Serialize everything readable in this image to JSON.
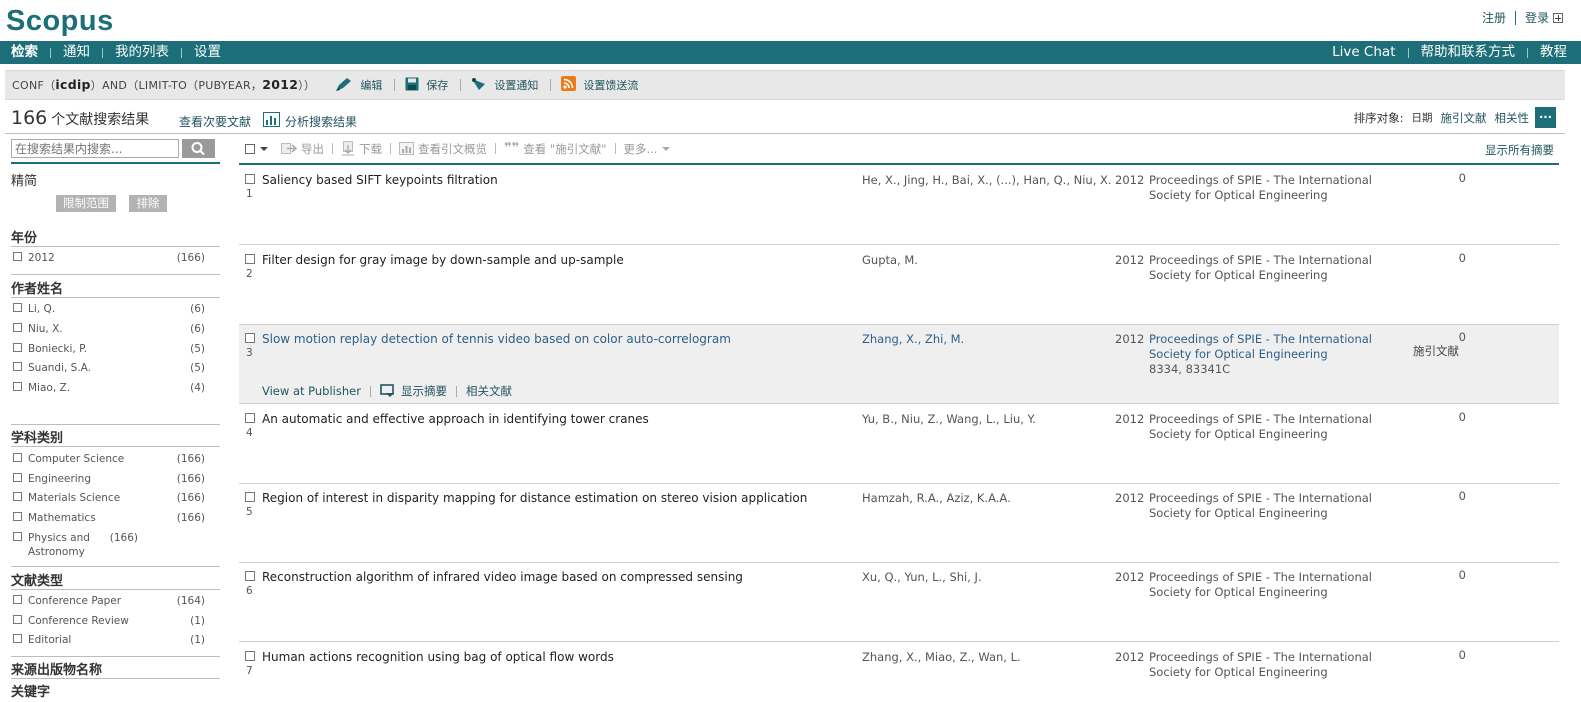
{
  "header": {
    "logo": "Scopus",
    "register": "注册",
    "login": "登录"
  },
  "nav": {
    "left": [
      "检索",
      "通知",
      "我的列表",
      "设置"
    ],
    "right": [
      "Live Chat",
      "帮助和联系方式",
      "教程"
    ]
  },
  "query": {
    "prefix": "CONF（",
    "term": "icdip",
    "mid": "）AND（LIMIT-TO（PUBYEAR，",
    "year": "2012",
    "suffix": "））",
    "actions": {
      "edit": "编辑",
      "save": "保存",
      "alert": "设置通知",
      "feed": "设置馈送流"
    }
  },
  "results_header": {
    "count": "166",
    "count_label": "个文献搜索结果",
    "secondary": "查看次要文献",
    "analyze": "分析搜索结果",
    "sort_label": "排序对象:",
    "sort_options": [
      "日期",
      "施引文献",
      "相关性"
    ],
    "more": "..."
  },
  "sidebar": {
    "search_placeholder": "在搜索结果内搜索...",
    "refine_title": "精简",
    "limit_label": "限制范围",
    "exclude_label": "排除",
    "facets": [
      {
        "title": "年份",
        "items": [
          {
            "name": "2012",
            "count": "(166)"
          }
        ]
      },
      {
        "title": "作者姓名",
        "items": [
          {
            "name": "Li, Q.",
            "count": "(6)"
          },
          {
            "name": "Niu, X.",
            "count": "(6)"
          },
          {
            "name": "Boniecki, P.",
            "count": "(5)"
          },
          {
            "name": "Suandi, S.A.",
            "count": "(5)"
          },
          {
            "name": "Miao, Z.",
            "count": "(4)"
          }
        ]
      },
      {
        "title": "学科类别",
        "items": [
          {
            "name": "Computer Science",
            "count": "(166)"
          },
          {
            "name": "Engineering",
            "count": "(166)"
          },
          {
            "name": "Materials Science",
            "count": "(166)"
          },
          {
            "name": "Mathematics",
            "count": "(166)"
          },
          {
            "name": "Physics and Astronomy",
            "count": "(166)"
          }
        ]
      },
      {
        "title": "文献类型",
        "items": [
          {
            "name": "Conference Paper",
            "count": "(164)"
          },
          {
            "name": "Conference Review",
            "count": "(1)"
          },
          {
            "name": "Editorial",
            "count": "(1)"
          }
        ]
      },
      {
        "title": "来源出版物名称",
        "items": []
      },
      {
        "title": "关键字",
        "items": []
      }
    ]
  },
  "toolbar": {
    "export": "导出",
    "download": "下载",
    "citation_overview": "查看引文概览",
    "view_cited": "查看 \"施引文献\"",
    "more": "更多...",
    "show_all_abstracts": "显示所有摘要"
  },
  "results": [
    {
      "num": "1",
      "title": "Saliency based SIFT keypoints filtration",
      "authors": "He, X., Jing, H., Bai, X., (...), Han, Q., Niu, X.",
      "year": "2012",
      "source": "Proceedings of SPIE - The International Society for Optical Engineering",
      "cited": "0"
    },
    {
      "num": "2",
      "title": "Filter design for gray image by down-sample and up-sample",
      "authors": "Gupta, M.",
      "year": "2012",
      "source": "Proceedings of SPIE - The International Society for Optical Engineering",
      "cited": "0"
    },
    {
      "num": "3",
      "title": "Slow motion replay detection of tennis video based on color auto-correlogram",
      "authors": "Zhang, X., Zhi, M.",
      "year": "2012",
      "source": "Proceedings of SPIE - The International Society for Optical Engineering",
      "pages": "8334, 83341C",
      "cited": "0",
      "cited_label": "施引文献",
      "actions": [
        "View at Publisher",
        "显示摘要",
        "相关文献"
      ]
    },
    {
      "num": "4",
      "title": "An automatic and effective approach in identifying tower cranes",
      "authors": "Yu, B., Niu, Z., Wang, L., Liu, Y.",
      "year": "2012",
      "source": "Proceedings of SPIE - The International Society for Optical Engineering",
      "cited": "0"
    },
    {
      "num": "5",
      "title": "Region of interest in disparity mapping for distance estimation on stereo vision application",
      "authors": "Hamzah, R.A., Aziz, K.A.A.",
      "year": "2012",
      "source": "Proceedings of SPIE - The International Society for Optical Engineering",
      "cited": "0"
    },
    {
      "num": "6",
      "title": "Reconstruction algorithm of infrared video image based on compressed sensing",
      "authors": "Xu, Q., Yun, L., Shi, J.",
      "year": "2012",
      "source": "Proceedings of SPIE - The International Society for Optical Engineering",
      "cited": "0"
    },
    {
      "num": "7",
      "title": "Human actions recognition using bag of optical flow words",
      "authors": "Zhang, X., Miao, Z., Wan, L.",
      "year": "2012",
      "source": "Proceedings of SPIE - The International Society for Optical Engineering",
      "cited": "0"
    }
  ],
  "colors": {
    "brand_teal": "#1c6e78",
    "link": "#22565f",
    "highlight_row": "#efefef",
    "rss_orange": "#f07a1a"
  }
}
